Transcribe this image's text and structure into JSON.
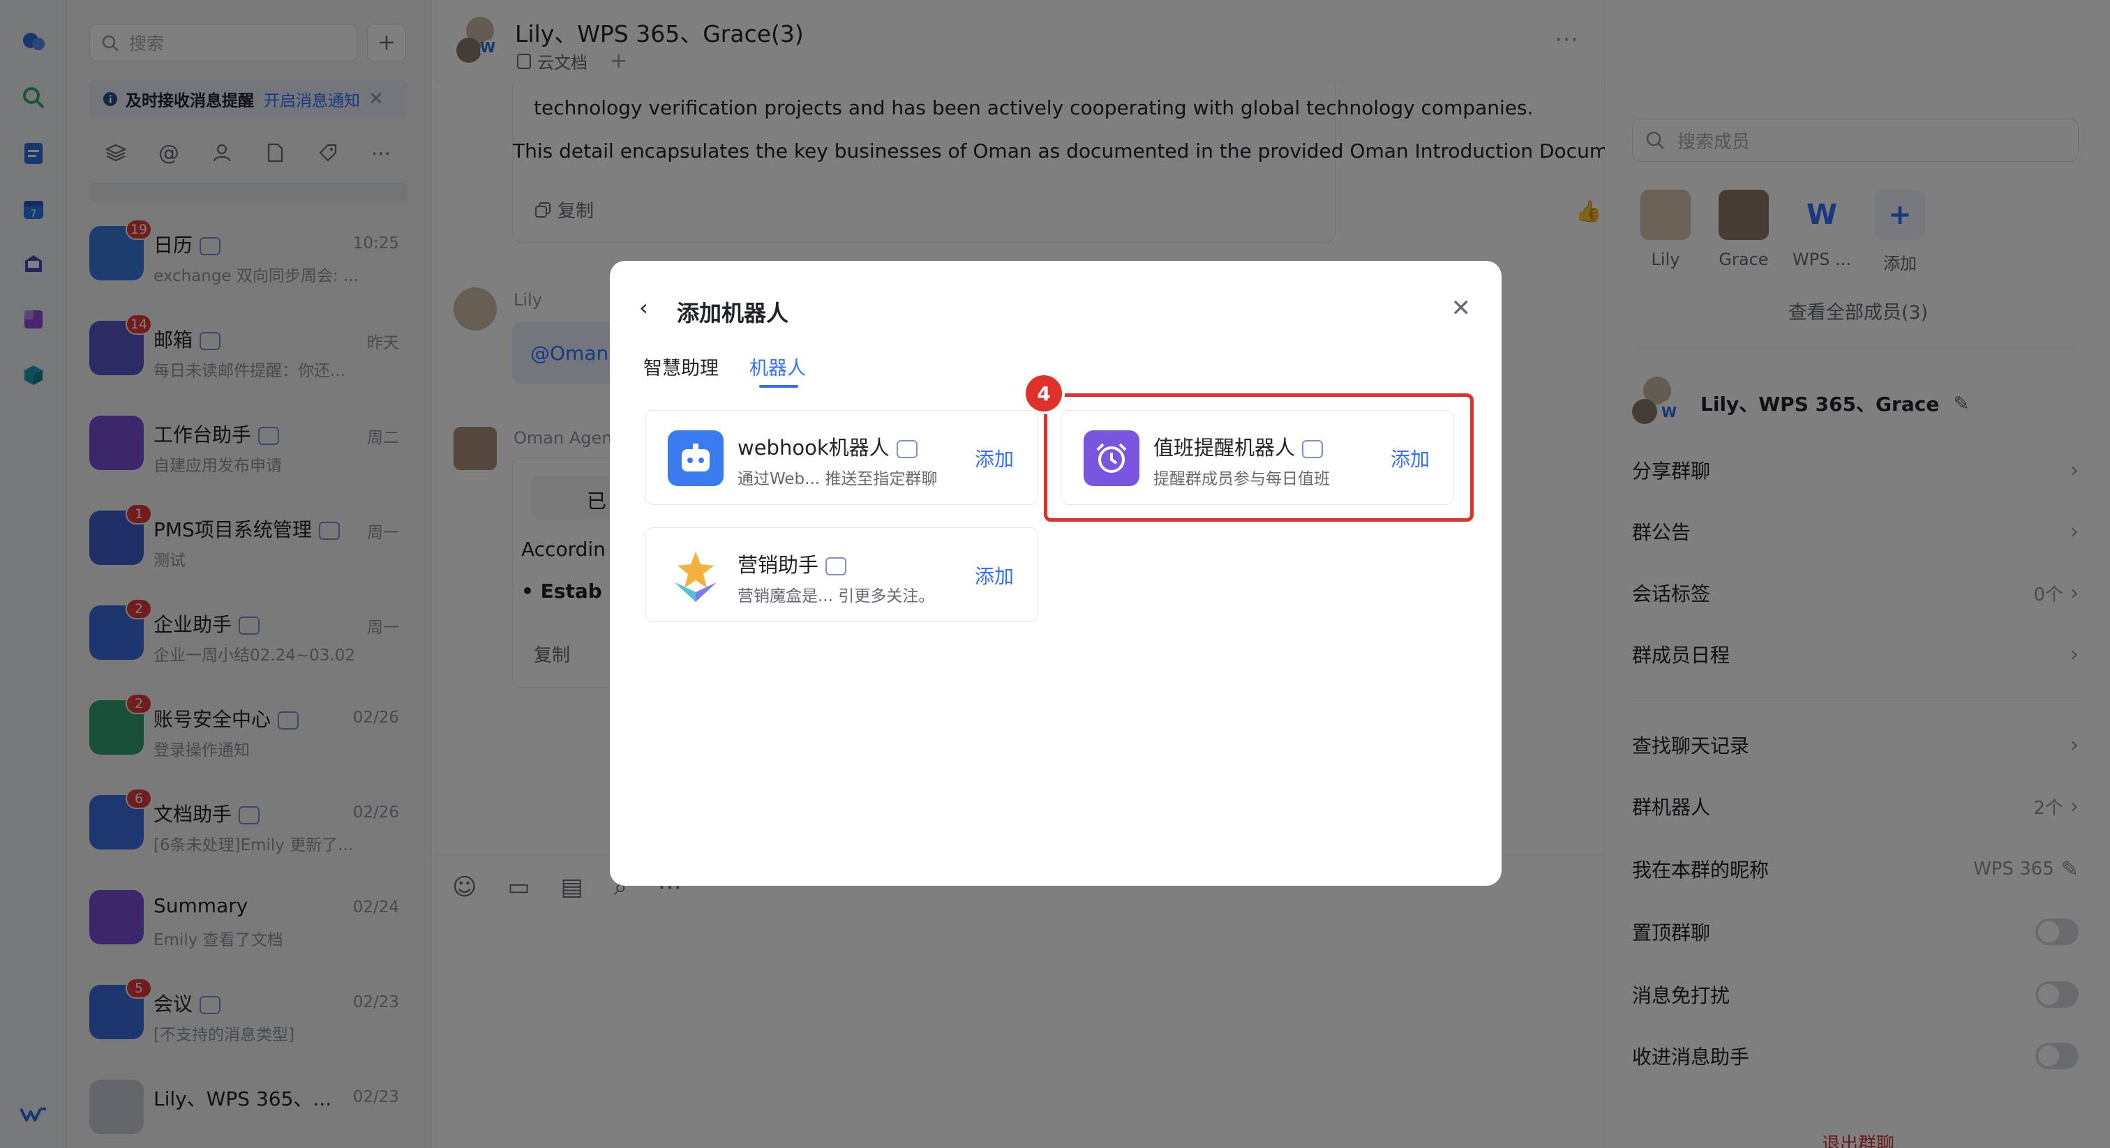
{
  "rail": {
    "icons": [
      "chat-icon",
      "search-icon",
      "docs-icon",
      "calendar-icon",
      "mail-icon",
      "workplace-icon",
      "app-cube-icon",
      "wps-logo-icon"
    ]
  },
  "sidebar": {
    "search_placeholder": "搜索",
    "notice": {
      "text": "及时接收消息提醒",
      "link": "开启消息通知"
    },
    "conversations": [
      {
        "name": "日历",
        "time": "10:25",
        "preview": "exchange 双向同步周会: ...",
        "badge": "19",
        "bot": true,
        "color": "#3a7bdc"
      },
      {
        "name": "邮箱",
        "time": "昨天",
        "preview": "每日未读邮件提醒：你还...",
        "badge": "14",
        "bot": true,
        "color": "#5a56c8"
      },
      {
        "name": "工作台助手",
        "time": "周二",
        "preview": "自建应用发布申请",
        "badge": "",
        "bot": true,
        "color": "#7a4fd6"
      },
      {
        "name": "PMS项目系统管理",
        "time": "周一",
        "preview": "测试",
        "badge": "1",
        "bot": true,
        "color": "#3f5fd0"
      },
      {
        "name": "企业助手",
        "time": "周一",
        "preview": "企业一周小结02.24~03.02",
        "badge": "2",
        "bot": true,
        "color": "#3a6fdc"
      },
      {
        "name": "账号安全中心",
        "time": "02/26",
        "preview": "登录操作通知",
        "badge": "2",
        "bot": true,
        "color": "#2f9e6e"
      },
      {
        "name": "文档助手",
        "time": "02/26",
        "preview": "[6条未处理]Emily 更新了...",
        "badge": "6",
        "bot": true,
        "color": "#3e6ee0"
      },
      {
        "name": "Summary",
        "time": "02/24",
        "preview": "Emily 查看了文档",
        "badge": "",
        "bot": false,
        "color": "#7a4fd6"
      },
      {
        "name": "会议",
        "time": "02/23",
        "preview": "[不支持的消息类型]",
        "badge": "5",
        "bot": true,
        "color": "#3a6fdc"
      },
      {
        "name": "Lily、WPS 365、...",
        "time": "02/23",
        "preview": "",
        "badge": "",
        "bot": false,
        "color": "#c9cdd4"
      }
    ]
  },
  "chat": {
    "title": "Lily、WPS 365、Grace(3)",
    "subtitle": "云文档",
    "msg1_line1": "technology verification projects and has been actively cooperating with global technology companies.",
    "msg1_line2": "This detail encapsulates the key businesses of Oman as documented in the provided Oman Introduction Document.",
    "copy_label": "复制",
    "lily_name": "Lily",
    "lily_msg": "@Oman",
    "agent_name": "Oman Agent",
    "agent_status": "已",
    "agent_line": "Accordin",
    "agent_bullet": "Estab",
    "copy2_label": "复制"
  },
  "right_panel": {
    "search_placeholder": "搜索成员",
    "members": [
      {
        "name": "Lily"
      },
      {
        "name": "Grace"
      },
      {
        "name": "WPS ..."
      },
      {
        "name": "添加"
      }
    ],
    "view_all": "查看全部成员(3)",
    "group_name": "Lily、WPS 365、Grace",
    "rows": [
      {
        "label": "分享群聊",
        "value": ""
      },
      {
        "label": "群公告",
        "value": ""
      },
      {
        "label": "会话标签",
        "value": "0个"
      },
      {
        "label": "群成员日程",
        "value": ""
      },
      {
        "label": "查找聊天记录",
        "value": ""
      },
      {
        "label": "群机器人",
        "value": "2个"
      },
      {
        "label": "我在本群的昵称",
        "value": "WPS 365"
      }
    ],
    "toggles": [
      {
        "label": "置顶群聊",
        "on": false
      },
      {
        "label": "消息免打扰",
        "on": false
      },
      {
        "label": "收进消息助手",
        "on": false
      }
    ],
    "exit": "退出群聊"
  },
  "modal": {
    "title": "添加机器人",
    "tabs": [
      {
        "label": "智慧助理",
        "active": false
      },
      {
        "label": "机器人",
        "active": true
      }
    ],
    "step_badge": "4",
    "highlight_color": "#e0302a",
    "cards": [
      {
        "title": "webhook机器人",
        "desc": "通过Web... 推送至指定群聊",
        "add": "添加",
        "icon": "webhook-robot-icon",
        "color": "#3b7bf0"
      },
      {
        "title": "值班提醒机器人",
        "desc": "提醒群成员参与每日值班",
        "add": "添加",
        "icon": "alarm-clock-icon",
        "color": "#7a55e0"
      },
      {
        "title": "营销助手",
        "desc": "营销魔盒是... 引更多关注。",
        "add": "添加",
        "icon": "marketing-star-icon",
        "color": "#f0a63b"
      }
    ]
  }
}
